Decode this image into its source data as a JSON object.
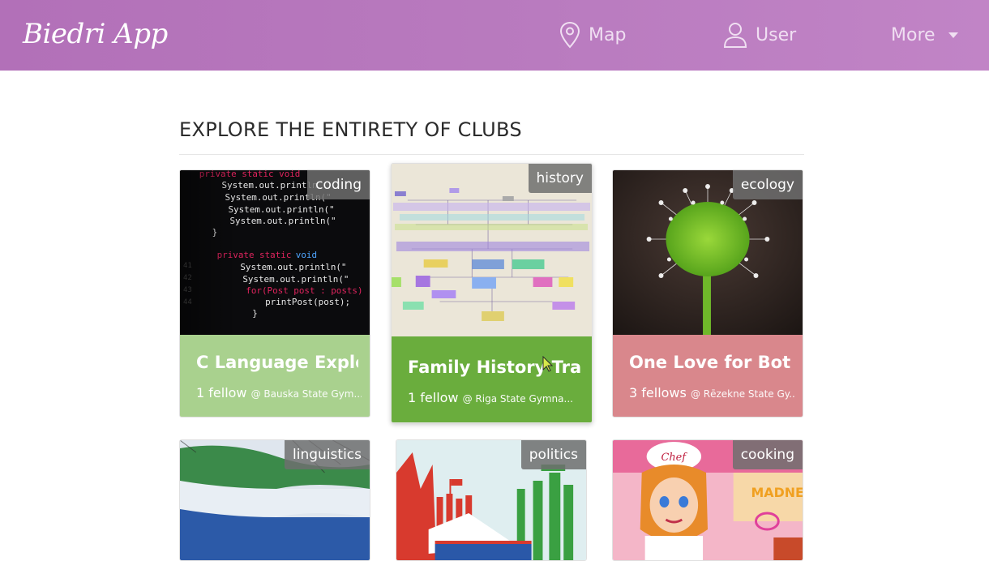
{
  "navbar": {
    "brand": "Biedri App",
    "map_label": "Map",
    "user_label": "User",
    "more_label": "More",
    "icons": {
      "map": "map-pin-icon",
      "user": "user-icon",
      "more": "caret-down-icon"
    },
    "colors": {
      "background": "#b97bbf",
      "text": "#f0dff2"
    }
  },
  "main": {
    "title": "EXPLORE THE ENTIRETY OF CLUBS"
  },
  "clubs": [
    {
      "category": "coding",
      "title": "C Language Explor...",
      "fellows": "1 fellow",
      "school": "@ Bauska State Gym...",
      "color": "#a9d18e"
    },
    {
      "category": "history",
      "title": "Family History Trac...",
      "fellows": "1 fellow",
      "school": "@ Riga State Gymna...",
      "color": "#6aad3d"
    },
    {
      "category": "ecology",
      "title": "One Love for Botany",
      "fellows": "3 fellows",
      "school": "@ Rēzekne State Gy...",
      "color": "#d9878c"
    },
    {
      "category": "linguistics"
    },
    {
      "category": "politics"
    },
    {
      "category": "cooking"
    }
  ]
}
